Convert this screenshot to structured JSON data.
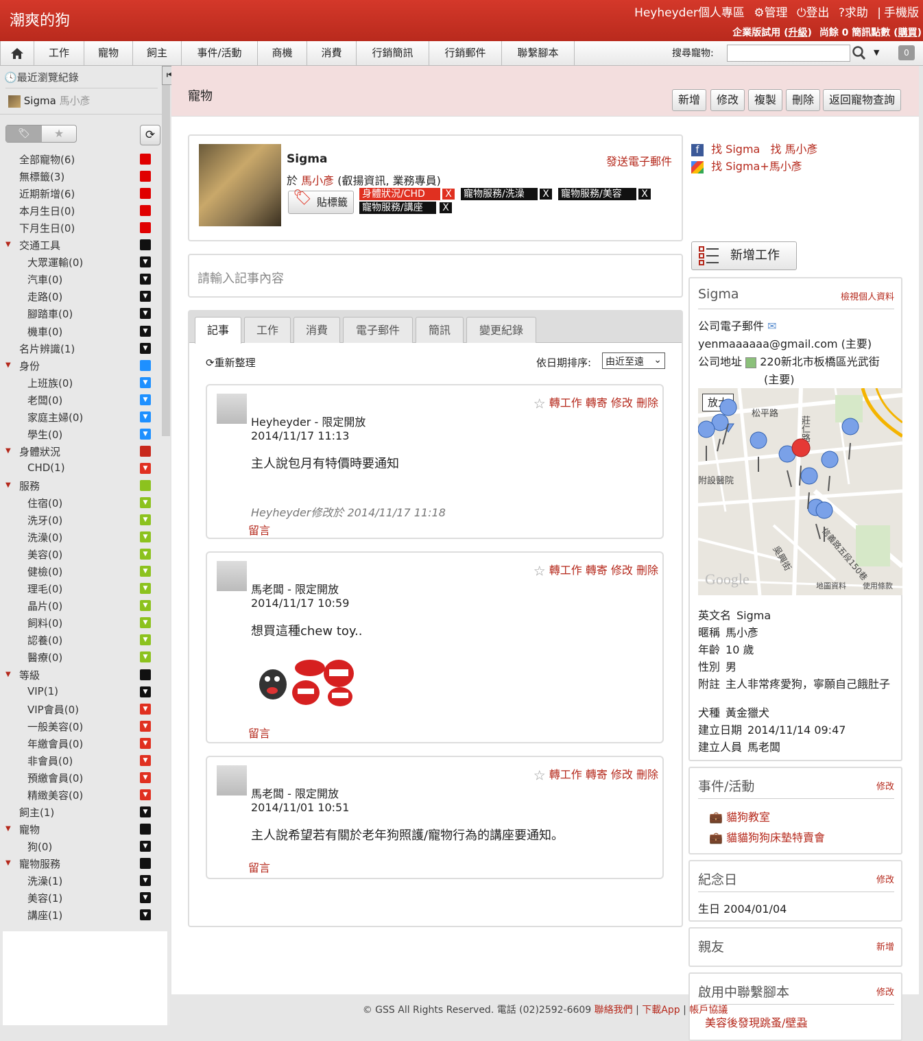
{
  "brand": "潮爽的狗",
  "top": {
    "user_area": "Heyheyder個人專區",
    "manage": "管理",
    "logout": "登出",
    "help": "求助",
    "mobile": "手機版",
    "trial": "企業版試用",
    "upgrade": "升級",
    "sms_left": "尚餘 0 簡訊點數",
    "buy": "購買"
  },
  "menu": [
    "工作",
    "寵物",
    "飼主",
    "事件/活動",
    "商機",
    "消費",
    "行銷簡訊",
    "行銷郵件",
    "聯繫腳本"
  ],
  "search": {
    "label": "搜尋寵物:",
    "value": "",
    "counter": "0"
  },
  "sidebar": {
    "recent_label": "最近瀏覽紀錄",
    "recent_name": "Sigma",
    "recent_owner": "馬小彥",
    "tree": [
      {
        "label": "全部寵物(6)",
        "color": "#e00000",
        "indent": 0,
        "type": "sq",
        "arrow": false
      },
      {
        "label": "無標籤(3)",
        "color": "#e00000",
        "indent": 0,
        "type": "sq",
        "arrow": false
      },
      {
        "label": "近期新增(6)",
        "color": "#e00000",
        "indent": 0,
        "type": "sq",
        "arrow": false
      },
      {
        "label": "本月生日(0)",
        "color": "#e00000",
        "indent": 0,
        "type": "sq",
        "arrow": false
      },
      {
        "label": "下月生日(0)",
        "color": "#e00000",
        "indent": 0,
        "type": "sq",
        "arrow": false
      },
      {
        "label": "交通工具",
        "color": "#111111",
        "indent": 0,
        "type": "sq",
        "arrow": true
      },
      {
        "label": "大眾運輸(0)",
        "color": "#111111",
        "indent": 1,
        "type": "tri",
        "arrow": false
      },
      {
        "label": "汽車(0)",
        "color": "#111111",
        "indent": 1,
        "type": "tri",
        "arrow": false
      },
      {
        "label": "走路(0)",
        "color": "#111111",
        "indent": 1,
        "type": "tri",
        "arrow": false
      },
      {
        "label": "腳踏車(0)",
        "color": "#111111",
        "indent": 1,
        "type": "tri",
        "arrow": false
      },
      {
        "label": "機車(0)",
        "color": "#111111",
        "indent": 1,
        "type": "tri",
        "arrow": false
      },
      {
        "label": "名片辨識(1)",
        "color": "#111111",
        "indent": 0,
        "type": "tri",
        "arrow": false
      },
      {
        "label": "身份",
        "color": "#1e90ff",
        "indent": 0,
        "type": "sq",
        "arrow": true
      },
      {
        "label": "上班族(0)",
        "color": "#1e90ff",
        "indent": 1,
        "type": "tri",
        "arrow": false
      },
      {
        "label": "老闆(0)",
        "color": "#1e90ff",
        "indent": 1,
        "type": "tri",
        "arrow": false
      },
      {
        "label": "家庭主婦(0)",
        "color": "#1e90ff",
        "indent": 1,
        "type": "tri",
        "arrow": false
      },
      {
        "label": "學生(0)",
        "color": "#1e90ff",
        "indent": 1,
        "type": "tri",
        "arrow": false
      },
      {
        "label": "身體狀況",
        "color": "#c8281b",
        "indent": 0,
        "type": "sq",
        "arrow": true
      },
      {
        "label": "CHD(1)",
        "color": "#e03020",
        "indent": 1,
        "type": "tri",
        "arrow": false
      },
      {
        "label": "服務",
        "color": "#8cc21e",
        "indent": 0,
        "type": "sq",
        "arrow": true
      },
      {
        "label": "住宿(0)",
        "color": "#8cc21e",
        "indent": 1,
        "type": "tri",
        "arrow": false
      },
      {
        "label": "洗牙(0)",
        "color": "#8cc21e",
        "indent": 1,
        "type": "tri",
        "arrow": false
      },
      {
        "label": "洗澡(0)",
        "color": "#8cc21e",
        "indent": 1,
        "type": "tri",
        "arrow": false
      },
      {
        "label": "美容(0)",
        "color": "#8cc21e",
        "indent": 1,
        "type": "tri",
        "arrow": false
      },
      {
        "label": "健檢(0)",
        "color": "#8cc21e",
        "indent": 1,
        "type": "tri",
        "arrow": false
      },
      {
        "label": "理毛(0)",
        "color": "#8cc21e",
        "indent": 1,
        "type": "tri",
        "arrow": false
      },
      {
        "label": "晶片(0)",
        "color": "#8cc21e",
        "indent": 1,
        "type": "tri",
        "arrow": false
      },
      {
        "label": "飼料(0)",
        "color": "#8cc21e",
        "indent": 1,
        "type": "tri",
        "arrow": false
      },
      {
        "label": "認養(0)",
        "color": "#8cc21e",
        "indent": 1,
        "type": "tri",
        "arrow": false
      },
      {
        "label": "醫療(0)",
        "color": "#8cc21e",
        "indent": 1,
        "type": "tri",
        "arrow": false
      },
      {
        "label": "等級",
        "color": "#111111",
        "indent": 0,
        "type": "sq",
        "arrow": true
      },
      {
        "label": "VIP(1)",
        "color": "#111111",
        "indent": 1,
        "type": "tri",
        "arrow": false
      },
      {
        "label": "VIP會員(0)",
        "color": "#e03020",
        "indent": 1,
        "type": "tri",
        "arrow": false
      },
      {
        "label": "一般美容(0)",
        "color": "#e03020",
        "indent": 1,
        "type": "tri",
        "arrow": false
      },
      {
        "label": "年繳會員(0)",
        "color": "#e03020",
        "indent": 1,
        "type": "tri",
        "arrow": false
      },
      {
        "label": "非會員(0)",
        "color": "#e03020",
        "indent": 1,
        "type": "tri",
        "arrow": false
      },
      {
        "label": "預繳會員(0)",
        "color": "#e03020",
        "indent": 1,
        "type": "tri",
        "arrow": false
      },
      {
        "label": "精緻美容(0)",
        "color": "#e03020",
        "indent": 1,
        "type": "tri",
        "arrow": false
      },
      {
        "label": "飼主(1)",
        "color": "#111111",
        "indent": 0,
        "type": "tri",
        "arrow": false
      },
      {
        "label": "寵物",
        "color": "#111111",
        "indent": 0,
        "type": "sq",
        "arrow": true
      },
      {
        "label": "狗(0)",
        "color": "#111111",
        "indent": 1,
        "type": "tri",
        "arrow": false
      },
      {
        "label": "寵物服務",
        "color": "#111111",
        "indent": 0,
        "type": "sq",
        "arrow": true
      },
      {
        "label": "洗澡(1)",
        "color": "#111111",
        "indent": 1,
        "type": "tri",
        "arrow": false
      },
      {
        "label": "美容(1)",
        "color": "#111111",
        "indent": 1,
        "type": "tri",
        "arrow": false
      },
      {
        "label": "講座(1)",
        "color": "#111111",
        "indent": 1,
        "type": "tri",
        "arrow": false
      }
    ]
  },
  "page": {
    "title": "寵物",
    "toolbar": [
      "新增",
      "修改",
      "複製",
      "刪除",
      "返回寵物查詢"
    ]
  },
  "pet": {
    "name": "Sigma",
    "owner_prefix": "於",
    "owner": "馬小彥",
    "owner_suffix": "(叡揚資訊, 業務專員)",
    "send_mail": "發送電子郵件",
    "tag_button": "貼標籤",
    "tags": [
      {
        "label": "身體狀況/CHD",
        "color": "#e03020"
      },
      {
        "label": "寵物服務/洗澡",
        "color": "#111111"
      },
      {
        "label": "寵物服務/美容",
        "color": "#111111"
      },
      {
        "label": "寵物服務/講座",
        "color": "#111111"
      }
    ],
    "tag_remove": "X"
  },
  "note_placeholder": "請輸入記事內容",
  "tabs": [
    "記事",
    "工作",
    "消費",
    "電子郵件",
    "簡訊",
    "變更紀錄"
  ],
  "feed": {
    "reorganize": "重新整理",
    "sort_label": "依日期排序:",
    "sort_value": "由近至遠",
    "actions": "轉工作 轉寄 修改 刪除",
    "comment": "留言",
    "posts": [
      {
        "author": "Heyheyder - 限定開放",
        "date": "2014/11/17 11:13",
        "text": "主人說包月有特價時要通知",
        "edited": "Heyheyder修改於 2014/11/17 11:18"
      },
      {
        "author": "馬老闆 - 限定開放",
        "date": "2014/11/17 10:59",
        "text": "想買這種chew toy..",
        "edited": ""
      },
      {
        "author": "馬老闆 - 限定開放",
        "date": "2014/11/01 10:51",
        "text": "主人說希望若有關於老年狗照護/寵物行為的講座要通知。",
        "edited": ""
      }
    ]
  },
  "right": {
    "fb": "找 Sigma",
    "fb2": "找 馬小彥",
    "google": "找 Sigma+馬小彥",
    "add_job": "新增工作",
    "profile": {
      "name": "Sigma",
      "view": "檢視個人資料",
      "email_label": "公司電子郵件",
      "email": "yenmaaaaaa@gmail.com (主要)",
      "addr_label": "公司地址",
      "addr": "220新北市板橋區光武街",
      "addr_main": "(主要)",
      "map_zoom": "放大",
      "map_label_1": "松平路",
      "map_label_2": "附設醫院",
      "map_label_3": "莊仁路",
      "map_label_4": "信義路五段150巷",
      "map_label_5": "吳興街",
      "map_data": "地圖資料",
      "map_terms": "使用條款",
      "google": "Google",
      "rows": [
        {
          "k": "英文名",
          "v": "Sigma"
        },
        {
          "k": "暱稱",
          "v": "馬小彥"
        },
        {
          "k": "年齡",
          "v": "10 歲"
        },
        {
          "k": "性別",
          "v": "男"
        },
        {
          "k": "附註",
          "v": "主人非常疼愛狗，寧願自己餓肚子"
        }
      ],
      "rows2": [
        {
          "k": "犬種",
          "v": "黃金獵犬"
        },
        {
          "k": "建立日期",
          "v": "2014/11/14 09:47"
        },
        {
          "k": "建立人員",
          "v": "馬老闆"
        }
      ]
    },
    "events": {
      "title": "事件/活動",
      "edit": "修改",
      "items": [
        "貓狗教室",
        "貓貓狗狗床墊特賣會"
      ]
    },
    "memorial": {
      "title": "紀念日",
      "edit": "修改",
      "value": "生日 2004/01/04"
    },
    "friends": {
      "title": "親友",
      "add": "新增"
    },
    "scripts": {
      "title": "啟用中聯繫腳本",
      "edit": "修改",
      "item": "美容後發現跳蚤/壁蝨"
    }
  },
  "footer": {
    "copyright": "© GSS All Rights Reserved. 電話 (02)2592-6609",
    "contact": "聯絡我們",
    "app": "下載App",
    "terms": "帳戶協議"
  }
}
